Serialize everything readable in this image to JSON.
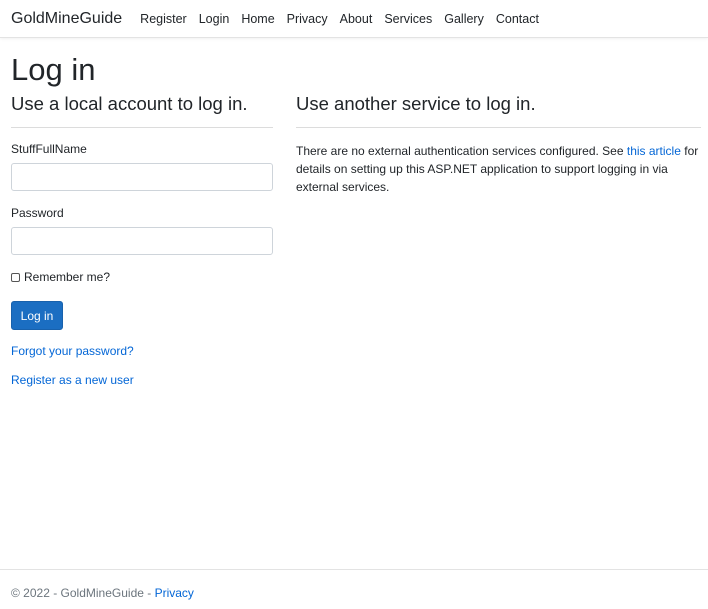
{
  "navbar": {
    "brand": "GoldMineGuide",
    "links": [
      "Register",
      "Login",
      "Home",
      "Privacy",
      "About",
      "Services",
      "Gallery",
      "Contact"
    ]
  },
  "main": {
    "title": "Log in",
    "local": {
      "heading": "Use a local account to log in.",
      "name_label": "StuffFullName",
      "name_value": "",
      "password_label": "Password",
      "password_value": "",
      "remember_label": "Remember me?",
      "remember_checked": false,
      "login_button": "Log in",
      "forgot_link": "Forgot your password?",
      "register_link": "Register as a new user"
    },
    "external": {
      "heading": "Use another service to log in.",
      "text_before": "There are no external authentication services configured. See ",
      "link_text": "this article",
      "text_after": " for details on setting up this ASP.NET application to support logging in via external services."
    }
  },
  "footer": {
    "text": "© 2022 - GoldMineGuide - ",
    "privacy_link": "Privacy"
  },
  "colors": {
    "primary_button": "#1b6ec2",
    "link": "#0366d6",
    "text": "#212529",
    "muted": "#6c757d"
  }
}
